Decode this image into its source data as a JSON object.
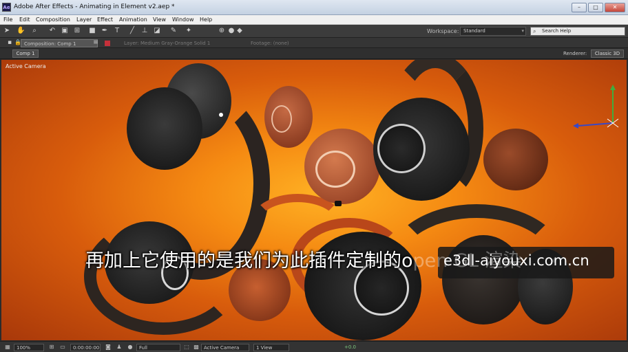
{
  "window": {
    "app_icon": "Ae",
    "title": "Adobe After Effects - Animating in Element v2.aep *",
    "controls": [
      "minimize-icon",
      "maximize-icon",
      "close-icon"
    ]
  },
  "menu": [
    "File",
    "Edit",
    "Composition",
    "Layer",
    "Effect",
    "Animation",
    "View",
    "Window",
    "Help"
  ],
  "toolbar": {
    "tools": [
      "selection-tool-icon",
      "hand-tool-icon",
      "zoom-tool-icon",
      "rotate-tool-icon",
      "camera-tool-icon",
      "pan-behind-tool-icon",
      "rectangle-tool-icon",
      "pen-tool-icon",
      "text-tool-icon",
      "brush-tool-icon",
      "clone-stamp-tool-icon",
      "eraser-tool-icon",
      "roto-brush-tool-icon",
      "puppet-tool-icon"
    ],
    "workspace_label": "Workspace:",
    "workspace_value": "Standard",
    "search_placeholder": "Search Help"
  },
  "panel_tabs": {
    "composition": "Composition: Comp 1",
    "layer": "Layer: Medium Gray-Orange Solid 1",
    "footage": "Footage: (none)"
  },
  "viewer_header": {
    "comp_chip": "Comp 1",
    "renderer_label": "Renderer:",
    "renderer_value": "Classic 3D"
  },
  "viewer": {
    "camera_label": "Active Camera",
    "background_colors": [
      "#ffb224",
      "#f58a12",
      "#d85c0c",
      "#a8380a"
    ]
  },
  "subtitle": {
    "text": "再加上它使用的是我们为此插件定制的o",
    "ghost_text": "pen GL 渲染"
  },
  "watermark": "e3dl-aiyouxi.com.cn",
  "status_bar": {
    "zoom": "100%",
    "timecode": "0:00:00:00",
    "resolution": "Full",
    "view": "Active Camera",
    "view_count": "1 View",
    "exposure": "+0.0"
  }
}
